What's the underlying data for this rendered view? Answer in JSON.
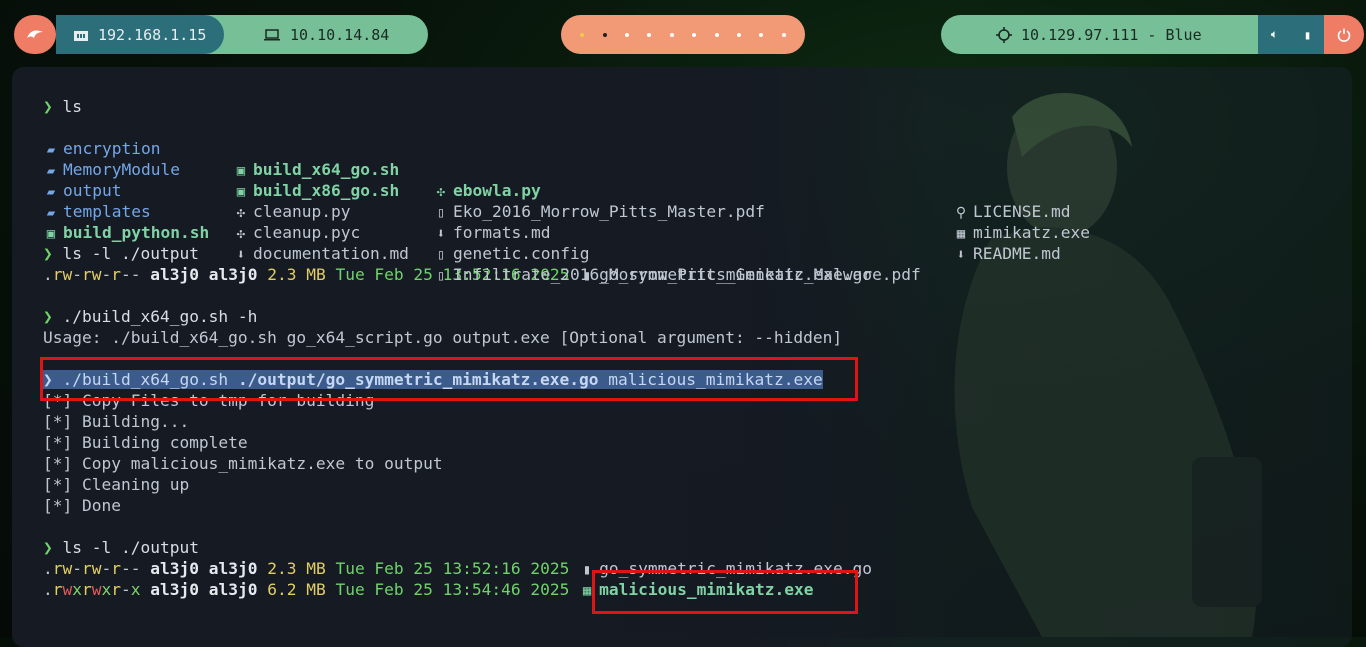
{
  "topbar": {
    "kali_icon": "kali-dragon-icon",
    "local_ip": "192.168.1.15",
    "vpn_ip": "10.10.14.84",
    "target": "10.129.97.111 - Blue",
    "tray_icons": [
      "volume-icon",
      "battery-icon"
    ],
    "colors": {
      "coral": "#ef7c64",
      "teal": "#2c6e7a",
      "green": "#76bf97",
      "orange": "#f29a76"
    }
  },
  "terminal": {
    "prompt": "❯",
    "cmd_ls": "ls",
    "ls_cols": {
      "c1": [
        "encryption",
        "MemoryModule",
        "output",
        "templates",
        "build_python.sh"
      ],
      "c2": [
        "build_x64_go.sh",
        "build_x86_go.sh",
        "cleanup.py",
        "cleanup.pyc",
        "documentation.md"
      ],
      "c3": [
        "ebowla.py",
        "Eko_2016_Morrow_Pitts_Master.pdf",
        "formats.md",
        "genetic.config",
        "Infiltrate_2016_Morrow_Pitts_Genetic_Malware.pdf"
      ],
      "c4": [
        "LICENSE.md",
        "mimikatz.exe",
        "README.md"
      ]
    },
    "cmd_ls_output": "ls -l ./output",
    "perm1": {
      "dot": ".",
      "a": "rw",
      "b": "-",
      "c": "rw",
      "d": "-",
      "e": "r",
      "f": "--"
    },
    "owner": "al3j0",
    "group": "al3j0",
    "row1": {
      "size": "2.3 MB",
      "date": "Tue Feb 25 13:52:16 2025",
      "name": "go_symmetric_mimikatz.exe.go"
    },
    "cmd_help": "./build_x64_go.sh -h",
    "usage": "Usage: ./build_x64_go.sh go_x64_script.go output.exe [Optional argument: --hidden]",
    "cmd_build_script": "./build_x64_go.sh",
    "cmd_build_arg": "./output/go_symmetric_mimikatz.exe.go",
    "cmd_build_out": "malicious_mimikatz.exe",
    "build_log": [
      "[*] Copy Files to tmp for building",
      "[*] Building...",
      "[*] Building complete",
      "[*] Copy malicious_mimikatz.exe to output",
      "[*] Cleaning up",
      "[*] Done"
    ],
    "row2": {
      "size": "6.2 MB",
      "date": "Tue Feb 25 13:54:46 2025",
      "name": "malicious_mimikatz.exe"
    }
  }
}
